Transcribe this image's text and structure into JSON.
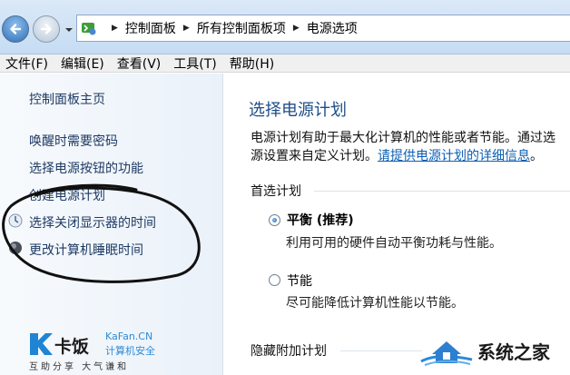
{
  "breadcrumb": [
    "控制面板",
    "所有控制面板项",
    "电源选项"
  ],
  "menu": [
    "文件(F)",
    "编辑(E)",
    "查看(V)",
    "工具(T)",
    "帮助(H)"
  ],
  "left_pane": {
    "home": "控制面板主页",
    "items": [
      "唤醒时需要密码",
      "选择电源按钮的功能",
      "创建电源计划",
      "选择关闭显示器的时间",
      "更改计算机睡眠时间"
    ]
  },
  "logo": {
    "name": "卡饭",
    "name_en": "KaFan.CN",
    "subtitle": "计算机安全",
    "tagline": "互助分享  大气谦和"
  },
  "content": {
    "title": "选择电源计划",
    "desc_line1": "电源计划有助于最大化计算机的性能或者节能。通过选",
    "desc_line2_prefix": "源设置来自定义计划。",
    "desc_link": "请提供电源计划的详细信息",
    "desc_line2_suffix": "。",
    "preferred_group": "首选计划",
    "plans": [
      {
        "name": "平衡 (推荐)",
        "desc": "利用可用的硬件自动平衡功耗与性能。",
        "selected": true
      },
      {
        "name": "节能",
        "desc": "尽可能降低计算机性能以节能。",
        "selected": false
      }
    ],
    "hidden_group": "隐藏附加计划"
  },
  "watermark": {
    "text": "系统之家"
  },
  "colors": {
    "title": "#1e4e88",
    "link": "#0b5fb5",
    "left_link": "#1e3a63",
    "logo_accent": "#2f8ad3"
  }
}
